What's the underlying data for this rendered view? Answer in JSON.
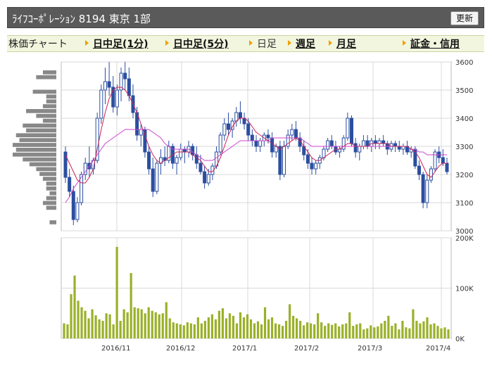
{
  "header": {
    "title": "ﾗｲﾌｺｰﾎﾟﾚｰｼｮﾝ  8194  東京 1部",
    "refresh_label": "更新"
  },
  "nav": {
    "label": "株価チャート",
    "items": [
      {
        "label": "日中足(1分)",
        "link": true
      },
      {
        "label": "日中足(5分)",
        "link": true
      },
      {
        "label": "日足",
        "link": false
      },
      {
        "label": "週足",
        "link": true
      },
      {
        "label": "月足",
        "link": true
      },
      {
        "label": "証金・信用",
        "link": true
      }
    ]
  },
  "colors": {
    "candle": "#2b4ea0",
    "ma_short": "#cc2255",
    "ma_long": "#cc44cc",
    "volume": "#9bb02a",
    "profile": "#888888",
    "grid": "#d8d8d8",
    "nav_arrow": "#f0a000"
  },
  "chart_data": [
    {
      "type": "candlestick",
      "title": "",
      "y_ticks": [
        "3600",
        "3500",
        "3400",
        "3300",
        "3200",
        "3100",
        "3000"
      ],
      "ylim": [
        3000,
        3600
      ],
      "x_ticks": [
        "2016/11",
        "2016/12",
        "2017/1",
        "2017/2",
        "2017/3",
        "2017/4"
      ],
      "grid": true,
      "series": [
        {
          "kind": "ohlc",
          "values": [
            [
              3280,
              3300,
              3170,
              3190
            ],
            [
              3190,
              3220,
              3120,
              3140
            ],
            [
              3140,
              3160,
              3020,
              3040
            ],
            [
              3040,
              3120,
              3030,
              3100
            ],
            [
              3100,
              3210,
              3090,
              3200
            ],
            [
              3200,
              3260,
              3180,
              3240
            ],
            [
              3240,
              3300,
              3190,
              3220
            ],
            [
              3220,
              3260,
              3200,
              3250
            ],
            [
              3250,
              3420,
              3240,
              3400
            ],
            [
              3400,
              3520,
              3380,
              3500
            ],
            [
              3500,
              3580,
              3450,
              3530
            ],
            [
              3530,
              3600,
              3480,
              3510
            ],
            [
              3510,
              3550,
              3420,
              3440
            ],
            [
              3440,
              3520,
              3410,
              3500
            ],
            [
              3500,
              3580,
              3460,
              3560
            ],
            [
              3560,
              3600,
              3500,
              3540
            ],
            [
              3540,
              3580,
              3460,
              3480
            ],
            [
              3480,
              3520,
              3400,
              3420
            ],
            [
              3420,
              3440,
              3320,
              3340
            ],
            [
              3340,
              3380,
              3300,
              3360
            ],
            [
              3360,
              3370,
              3260,
              3280
            ],
            [
              3280,
              3300,
              3200,
              3220
            ],
            [
              3220,
              3260,
              3120,
              3140
            ],
            [
              3140,
              3250,
              3130,
              3240
            ],
            [
              3240,
              3290,
              3200,
              3260
            ],
            [
              3260,
              3300,
              3230,
              3250
            ],
            [
              3250,
              3320,
              3240,
              3300
            ],
            [
              3300,
              3310,
              3220,
              3240
            ],
            [
              3240,
              3270,
              3200,
              3260
            ],
            [
              3260,
              3310,
              3250,
              3290
            ],
            [
              3290,
              3300,
              3240,
              3280
            ],
            [
              3280,
              3320,
              3260,
              3300
            ],
            [
              3300,
              3310,
              3250,
              3270
            ],
            [
              3270,
              3300,
              3220,
              3240
            ],
            [
              3240,
              3270,
              3200,
              3210
            ],
            [
              3210,
              3230,
              3150,
              3170
            ],
            [
              3170,
              3220,
              3160,
              3200
            ],
            [
              3200,
              3240,
              3180,
              3230
            ],
            [
              3230,
              3300,
              3220,
              3280
            ],
            [
              3280,
              3350,
              3270,
              3340
            ],
            [
              3340,
              3400,
              3320,
              3380
            ],
            [
              3380,
              3420,
              3340,
              3360
            ],
            [
              3360,
              3400,
              3330,
              3390
            ],
            [
              3390,
              3440,
              3370,
              3420
            ],
            [
              3420,
              3460,
              3380,
              3400
            ],
            [
              3400,
              3420,
              3360,
              3380
            ],
            [
              3380,
              3400,
              3320,
              3340
            ],
            [
              3340,
              3360,
              3300,
              3320
            ],
            [
              3320,
              3340,
              3280,
              3300
            ],
            [
              3300,
              3330,
              3280,
              3320
            ],
            [
              3320,
              3350,
              3300,
              3340
            ],
            [
              3340,
              3360,
              3310,
              3330
            ],
            [
              3330,
              3350,
              3260,
              3280
            ],
            [
              3280,
              3310,
              3260,
              3300
            ],
            [
              3300,
              3320,
              3180,
              3200
            ],
            [
              3200,
              3320,
              3190,
              3300
            ],
            [
              3300,
              3360,
              3290,
              3340
            ],
            [
              3340,
              3380,
              3320,
              3360
            ],
            [
              3360,
              3390,
              3320,
              3330
            ],
            [
              3330,
              3350,
              3280,
              3300
            ],
            [
              3300,
              3320,
              3250,
              3270
            ],
            [
              3270,
              3290,
              3220,
              3240
            ],
            [
              3240,
              3260,
              3200,
              3220
            ],
            [
              3220,
              3250,
              3200,
              3240
            ],
            [
              3240,
              3270,
              3220,
              3260
            ],
            [
              3260,
              3300,
              3250,
              3290
            ],
            [
              3290,
              3330,
              3280,
              3320
            ],
            [
              3320,
              3340,
              3290,
              3300
            ],
            [
              3300,
              3320,
              3270,
              3280
            ],
            [
              3280,
              3300,
              3260,
              3290
            ],
            [
              3290,
              3340,
              3280,
              3330
            ],
            [
              3330,
              3420,
              3320,
              3400
            ],
            [
              3400,
              3410,
              3300,
              3310
            ],
            [
              3310,
              3330,
              3260,
              3280
            ],
            [
              3280,
              3310,
              3250,
              3300
            ],
            [
              3300,
              3340,
              3290,
              3320
            ],
            [
              3320,
              3340,
              3290,
              3300
            ],
            [
              3300,
              3330,
              3280,
              3320
            ],
            [
              3320,
              3340,
              3290,
              3310
            ],
            [
              3310,
              3330,
              3290,
              3320
            ],
            [
              3320,
              3340,
              3300,
              3310
            ],
            [
              3310,
              3320,
              3270,
              3290
            ],
            [
              3290,
              3320,
              3280,
              3310
            ],
            [
              3310,
              3320,
              3280,
              3300
            ],
            [
              3300,
              3320,
              3280,
              3290
            ],
            [
              3290,
              3310,
              3270,
              3300
            ],
            [
              3300,
              3320,
              3270,
              3280
            ],
            [
              3280,
              3300,
              3260,
              3290
            ],
            [
              3290,
              3300,
              3220,
              3230
            ],
            [
              3230,
              3250,
              3180,
              3200
            ],
            [
              3200,
              3210,
              3080,
              3100
            ],
            [
              3100,
              3200,
              3080,
              3180
            ],
            [
              3180,
              3230,
              3170,
              3220
            ],
            [
              3220,
              3290,
              3210,
              3280
            ],
            [
              3280,
              3300,
              3240,
              3260
            ],
            [
              3260,
              3290,
              3230,
              3240
            ],
            [
              3240,
              3260,
              3200,
              3210
            ]
          ]
        },
        {
          "kind": "ma_short",
          "values": [
            3270,
            3240,
            3210,
            3180,
            3170,
            3170,
            3190,
            3220,
            3290,
            3360,
            3420,
            3470,
            3500,
            3510,
            3510,
            3500,
            3480,
            3450,
            3420,
            3380,
            3340,
            3300,
            3270,
            3250,
            3240,
            3250,
            3260,
            3270,
            3280,
            3280,
            3280,
            3280,
            3270,
            3260,
            3250,
            3230,
            3210,
            3210,
            3230,
            3260,
            3300,
            3340,
            3370,
            3390,
            3400,
            3400,
            3390,
            3370,
            3350,
            3340,
            3330,
            3320,
            3310,
            3300,
            3290,
            3300,
            3310,
            3320,
            3330,
            3320,
            3300,
            3280,
            3260,
            3250,
            3250,
            3260,
            3270,
            3280,
            3290,
            3290,
            3300,
            3310,
            3310,
            3300,
            3300,
            3300,
            3300,
            3310,
            3310,
            3310,
            3310,
            3310,
            3300,
            3300,
            3300,
            3300,
            3300,
            3290,
            3280,
            3260,
            3230,
            3200,
            3190,
            3210,
            3230,
            3240,
            3240
          ]
        },
        {
          "kind": "ma_long",
          "values": [
            3100,
            3120,
            3150,
            3170,
            3190,
            3210,
            3230,
            3250,
            3270,
            3290,
            3310,
            3320,
            3330,
            3340,
            3350,
            3360,
            3360,
            3360,
            3360,
            3360,
            3360,
            3360,
            3350,
            3340,
            3330,
            3310,
            3300,
            3290,
            3290,
            3290,
            3290,
            3290,
            3280,
            3270,
            3260,
            3250,
            3250,
            3250,
            3260,
            3270,
            3280,
            3290,
            3300,
            3310,
            3320,
            3320,
            3320,
            3320,
            3320,
            3320,
            3320,
            3320,
            3330,
            3330,
            3330,
            3330,
            3330,
            3330,
            3330,
            3330,
            3320,
            3310,
            3300,
            3300,
            3300,
            3300,
            3300,
            3300,
            3300,
            3300,
            3300,
            3300,
            3300,
            3300,
            3300,
            3300,
            3300,
            3300,
            3300,
            3300,
            3300,
            3300,
            3300,
            3300,
            3300,
            3300,
            3300,
            3290,
            3290,
            3280,
            3280,
            3270,
            3270,
            3270,
            3270,
            3270,
            3270
          ]
        }
      ]
    },
    {
      "type": "bar",
      "title": "",
      "y_ticks": [
        "200K",
        "100K",
        "0K"
      ],
      "ylim": [
        0,
        200000
      ],
      "x_ticks": [
        "2016/11",
        "2016/12",
        "2017/1",
        "2017/2",
        "2017/3",
        "2017/4"
      ],
      "grid": true,
      "values": [
        30000,
        28000,
        88000,
        125000,
        75000,
        62000,
        55000,
        40000,
        58000,
        46000,
        38000,
        35000,
        50000,
        48000,
        28000,
        182000,
        35000,
        58000,
        52000,
        130000,
        62000,
        60000,
        58000,
        50000,
        62000,
        55000,
        52000,
        48000,
        50000,
        72000,
        40000,
        32000,
        30000,
        28000,
        26000,
        32000,
        30000,
        28000,
        42000,
        30000,
        35000,
        42000,
        48000,
        38000,
        55000,
        60000,
        40000,
        50000,
        45000,
        30000,
        52000,
        42000,
        48000,
        38000,
        30000,
        34000,
        28000,
        62000,
        38000,
        42000,
        30000,
        28000,
        25000,
        35000,
        68000,
        45000,
        40000,
        35000,
        26000,
        32000,
        30000,
        28000,
        50000,
        32000,
        25000,
        30000,
        27000,
        30000,
        24000,
        28000,
        30000,
        52000,
        25000,
        28000,
        30000,
        18000,
        20000,
        26000,
        22000,
        24000,
        30000,
        35000,
        45000,
        25000,
        30000,
        18000,
        35000,
        22000,
        20000,
        58000,
        35000,
        30000,
        34000,
        42000,
        28000,
        30000,
        25000,
        20000,
        22000,
        18000
      ]
    },
    {
      "type": "bar",
      "title": "",
      "orientation": "horizontal",
      "values": [
        4,
        6,
        0,
        0,
        7,
        3,
        3,
        4,
        9,
        6,
        4,
        10,
        9,
        12,
        11,
        13,
        12,
        13,
        10,
        8,
        6,
        5,
        4,
        3,
        3,
        2,
        3,
        4,
        3,
        0,
        0,
        2
      ]
    }
  ]
}
